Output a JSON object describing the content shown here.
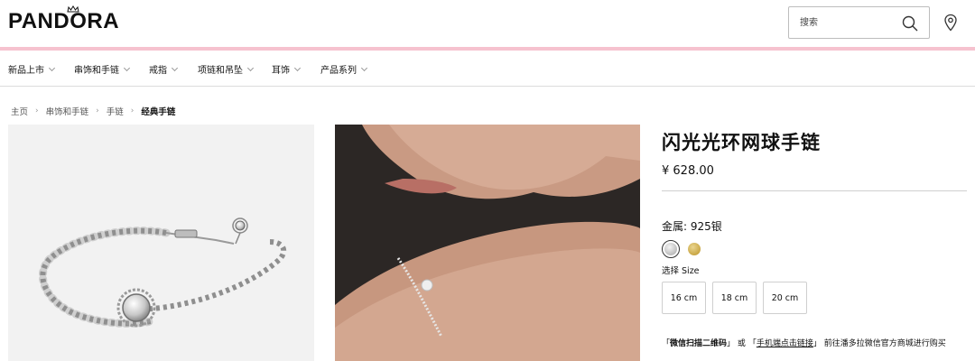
{
  "header": {
    "logo": "PANDORA",
    "search_placeholder": "搜索"
  },
  "nav": {
    "items": [
      {
        "label": "新品上市"
      },
      {
        "label": "串饰和手链"
      },
      {
        "label": "戒指"
      },
      {
        "label": "项链和吊坠"
      },
      {
        "label": "耳饰"
      },
      {
        "label": "产品系列"
      }
    ]
  },
  "breadcrumb": {
    "items": [
      "主页",
      "串饰和手链",
      "手链"
    ],
    "current": "经典手链",
    "separator": "›"
  },
  "product": {
    "title": "闪光光环网球手链",
    "price": "¥ 628.00",
    "metal_label": "金属: 925银",
    "size_label": "选择 Size",
    "sizes": [
      "16 cm",
      "18 cm",
      "20 cm"
    ],
    "metal_options": [
      {
        "name": "silver",
        "color": "#c9c9c9",
        "selected": true
      },
      {
        "name": "gold",
        "color": "#d4b45a",
        "selected": false
      }
    ]
  },
  "purchase_note": {
    "quote_open": "「",
    "quote_close": "」",
    "wechat_scan": "微信扫描二维码",
    "or": "或",
    "mobile_link": "手机端点击链接",
    "suffix": "前往潘多拉微信官方商城进行购买"
  },
  "colors": {
    "accent_pink": "#f6c2cf",
    "text": "#111111"
  }
}
